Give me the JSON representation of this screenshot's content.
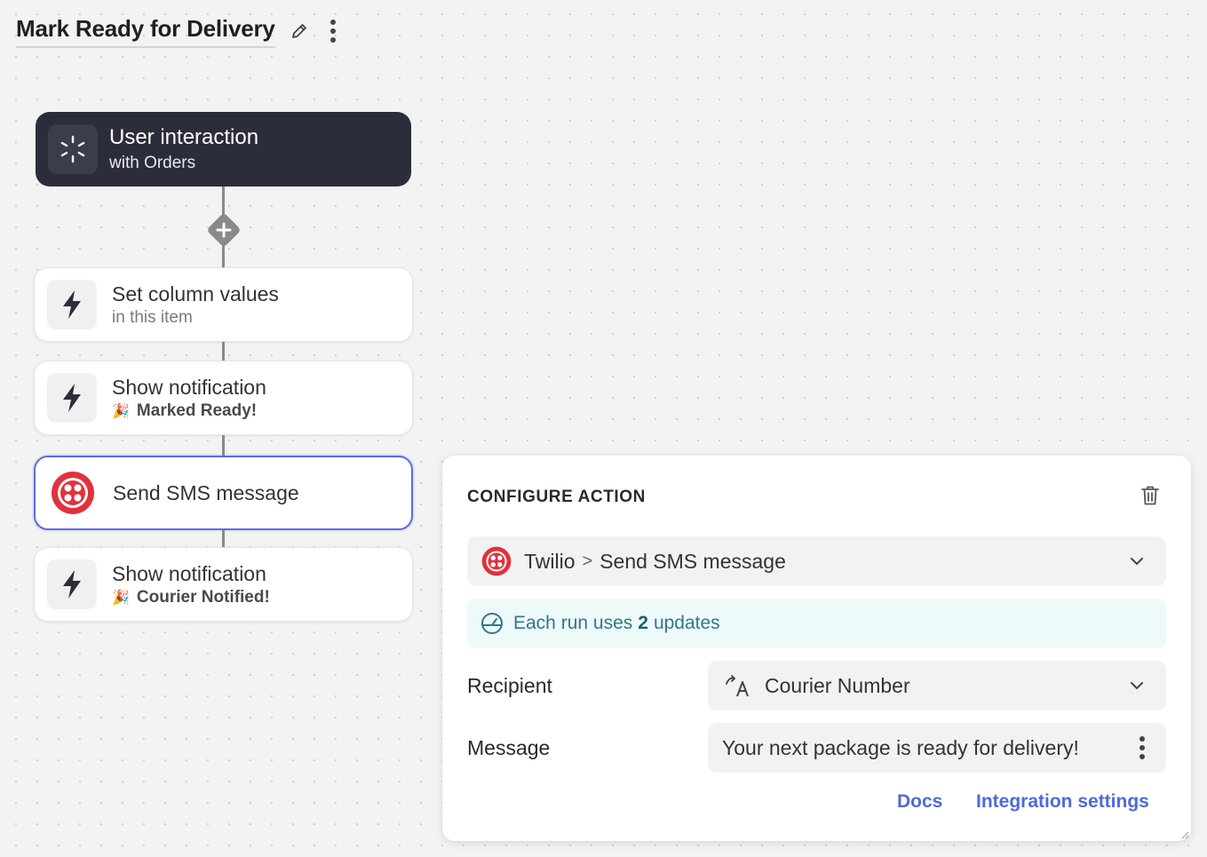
{
  "header": {
    "title": "Mark Ready for Delivery"
  },
  "trigger": {
    "title": "User interaction",
    "subtitle": "with Orders"
  },
  "steps": [
    {
      "title": "Set column values",
      "subtitle": "in this item"
    },
    {
      "title": "Show notification",
      "emoji": "🎉",
      "subtitle": "Marked Ready!"
    },
    {
      "title": "Send SMS message"
    },
    {
      "title": "Show notification",
      "emoji": "🎉",
      "subtitle": "Courier Notified!"
    }
  ],
  "panel": {
    "heading": "CONFIGURE ACTION",
    "action": {
      "integration": "Twilio",
      "separator": ">",
      "action": "Send SMS message"
    },
    "info": {
      "prefix": "Each run uses",
      "count": "2",
      "suffix": "updates"
    },
    "recipient": {
      "label": "Recipient",
      "value": "Courier Number"
    },
    "message": {
      "label": "Message",
      "value": "Your next package is ready for delivery!"
    },
    "links": {
      "docs": "Docs",
      "integration_settings": "Integration settings"
    }
  },
  "colors": {
    "accent": "#5c6ee0",
    "twilio_red": "#e0323c",
    "trigger_bg": "#2c2d3a",
    "info_text": "#2d7a86",
    "link": "#4e6ad9"
  },
  "icons": {
    "edit": "pencil-icon",
    "more": "kebab-menu-icon",
    "trigger": "spinner-icon",
    "add": "plus-icon",
    "action": "lightning-icon",
    "sms": "twilio-icon",
    "trash": "trash-icon",
    "chevron": "chevron-down-icon",
    "gauge": "gauge-icon",
    "variable": "variable-icon"
  }
}
